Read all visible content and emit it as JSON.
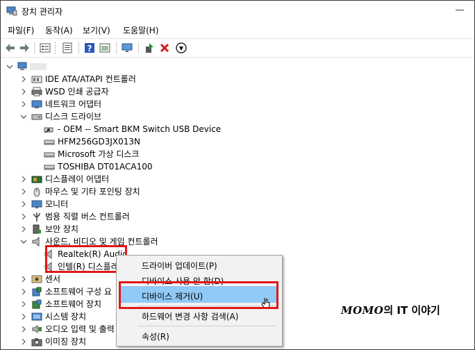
{
  "window": {
    "title": "장치 관리자",
    "minimize_glyph": "—"
  },
  "menu": [
    "파일(F)",
    "동작(A)",
    "보기(V)",
    "도움말(H)"
  ],
  "toolbar": [
    {
      "icon": "back-arrow-icon",
      "color": "#6a7f6a"
    },
    {
      "icon": "forward-arrow-icon",
      "color": "#6a7f6a"
    },
    {
      "icon": "properties-icon",
      "color": "#555555"
    },
    {
      "icon": "list-icon",
      "color": "#555555"
    },
    {
      "icon": "help-icon",
      "color": "#2a58b8"
    },
    {
      "icon": "view-icon",
      "color": "#555555"
    },
    {
      "icon": "scan-monitor-icon",
      "color": "#2a6fb8"
    },
    {
      "icon": "update-driver-icon",
      "color": "#1f8a3a"
    },
    {
      "icon": "uninstall-x-icon",
      "color": "#d41919"
    },
    {
      "icon": "download-arrow-icon",
      "color": "#000000"
    }
  ],
  "tree": [
    {
      "label": "",
      "icon": "computer-icon",
      "exp": "v"
    },
    {
      "label": "IDE ATA/ATAPI 컨트롤러",
      "icon": "ide-controller-icon",
      "exp": ">"
    },
    {
      "label": "WSD 인쇄 공급자",
      "icon": "printer-icon",
      "exp": ">"
    },
    {
      "label": "네트워크 어댑터",
      "icon": "network-adapter-icon",
      "exp": ">"
    },
    {
      "label": "디스크 드라이브",
      "icon": "disk-drive-icon",
      "exp": "v"
    },
    {
      "label": "- OEM -- Smart BKM Switch USB Device",
      "icon": "usb-disk-icon",
      "exp": ""
    },
    {
      "label": "HFM256GD3JX013N",
      "icon": "disk-icon",
      "exp": ""
    },
    {
      "label": "Microsoft 가상 디스크",
      "icon": "disk-icon",
      "exp": ""
    },
    {
      "label": "TOSHIBA DT01ACA100",
      "icon": "disk-icon",
      "exp": ""
    },
    {
      "label": "디스플레이 어댑터",
      "icon": "display-adapter-icon",
      "exp": ">"
    },
    {
      "label": "마우스 및 기타 포인팅 장치",
      "icon": "mouse-icon",
      "exp": ">"
    },
    {
      "label": "모니터",
      "icon": "monitor-icon",
      "exp": ">"
    },
    {
      "label": "범용 직렬 버스 컨트롤러",
      "icon": "usb-controller-icon",
      "exp": ">"
    },
    {
      "label": "보안 장치",
      "icon": "security-device-icon",
      "exp": ">"
    },
    {
      "label": "사운드, 비디오 및 게임 컨트롤러",
      "icon": "speaker-icon",
      "exp": "v"
    },
    {
      "label": "Realtek(R) Audio",
      "icon": "speaker-icon",
      "exp": ""
    },
    {
      "label": "인텔(R) 디스플레",
      "icon": "speaker-icon",
      "exp": ""
    },
    {
      "label": "센서",
      "icon": "sensor-icon",
      "exp": ">"
    },
    {
      "label": "소프트웨어 구성 요",
      "icon": "software-component-icon",
      "exp": ">"
    },
    {
      "label": "소프트웨어 장치",
      "icon": "software-device-icon",
      "exp": ">"
    },
    {
      "label": "시스템 장치",
      "icon": "system-device-icon",
      "exp": ">"
    },
    {
      "label": "오디오 입력 및 출력",
      "icon": "audio-io-icon",
      "exp": ">"
    },
    {
      "label": "이미징 장치",
      "icon": "camera-icon",
      "exp": ">"
    }
  ],
  "context_menu": {
    "items": [
      "드라이버 업데이트(P)",
      "디바이스 사용 안 함(D)",
      "디바이스 제거(U)",
      "하드웨어 변경 사항 검색(A)",
      "속성(R)"
    ],
    "highlighted_index": 2
  },
  "watermark": {
    "brand": "MOMO",
    "text": "의 IT 이야기"
  },
  "colors": {
    "accent_red": "#e0181a",
    "highlight_blue": "#91c9f7"
  }
}
